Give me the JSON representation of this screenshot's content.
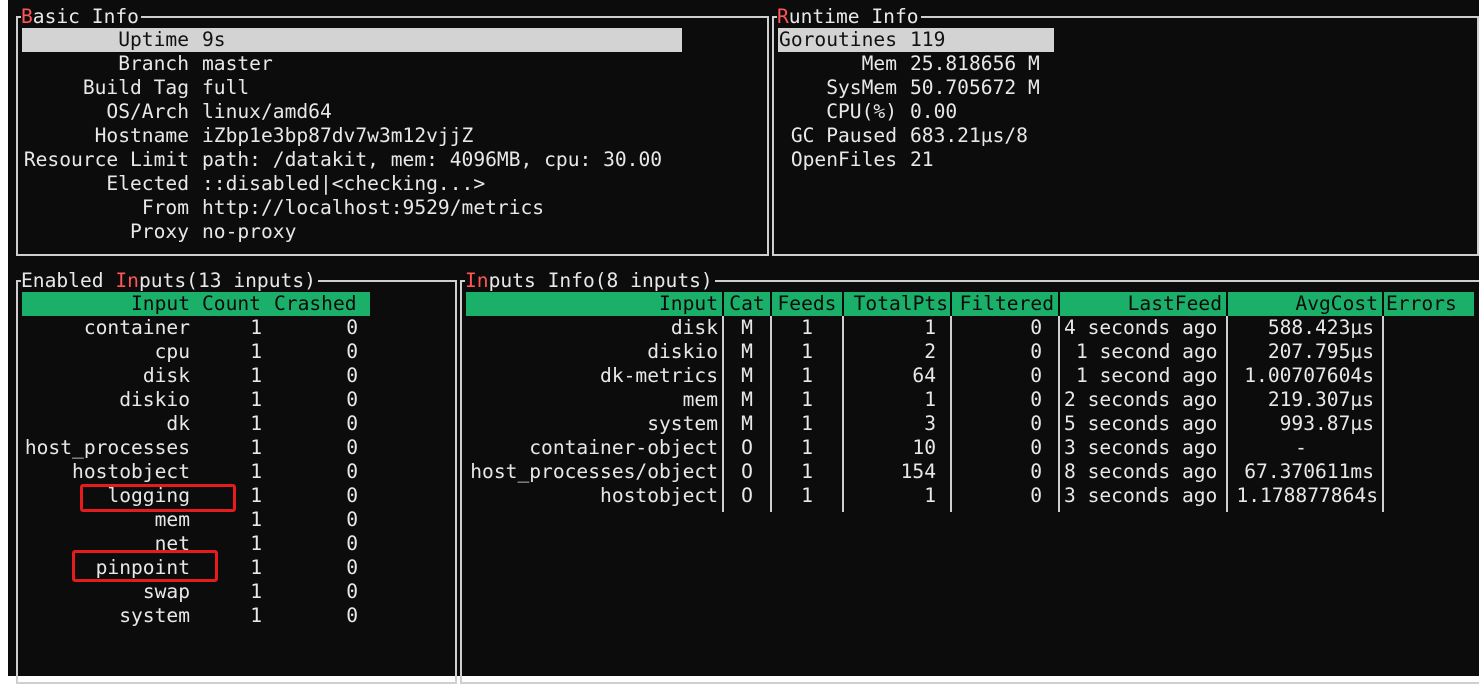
{
  "basic_info": {
    "title_first": "B",
    "title_rest": "asic Info",
    "rows": [
      {
        "label": "Uptime",
        "value": "9s"
      },
      {
        "label": "Branch",
        "value": "master"
      },
      {
        "label": "Build Tag",
        "value": "full"
      },
      {
        "label": "OS/Arch",
        "value": "linux/amd64"
      },
      {
        "label": "Hostname",
        "value": "iZbp1e3bp87dv7w3m12vjjZ"
      },
      {
        "label": "Resource Limit",
        "value": "path: /datakit, mem: 4096MB, cpu: 30.00"
      },
      {
        "label": "Elected",
        "value": "::disabled|<checking...>"
      },
      {
        "label": "From",
        "value": "http://localhost:9529/metrics"
      },
      {
        "label": "Proxy",
        "value": "no-proxy"
      }
    ]
  },
  "runtime_info": {
    "title_first": "R",
    "title_rest": "untime Info",
    "rows": [
      {
        "label": "Goroutines",
        "value": "119"
      },
      {
        "label": "Mem",
        "value": "25.818656 M"
      },
      {
        "label": "SysMem",
        "value": "50.705672 M"
      },
      {
        "label": "CPU(%)",
        "value": "0.00"
      },
      {
        "label": "GC Paused",
        "value": "683.21µs/8"
      },
      {
        "label": "OpenFiles",
        "value": "21"
      }
    ]
  },
  "enabled_inputs": {
    "title_a": "Enabled ",
    "title_hl": "In",
    "title_b": "puts(13 inputs)",
    "headers": {
      "input": "Input",
      "count": "Count",
      "crashed": "Crashed"
    },
    "rows": [
      {
        "input": "container",
        "count": "1",
        "crashed": "0"
      },
      {
        "input": "cpu",
        "count": "1",
        "crashed": "0"
      },
      {
        "input": "disk",
        "count": "1",
        "crashed": "0"
      },
      {
        "input": "diskio",
        "count": "1",
        "crashed": "0"
      },
      {
        "input": "dk",
        "count": "1",
        "crashed": "0"
      },
      {
        "input": "host_processes",
        "count": "1",
        "crashed": "0"
      },
      {
        "input": "hostobject",
        "count": "1",
        "crashed": "0"
      },
      {
        "input": "logging",
        "count": "1",
        "crashed": "0"
      },
      {
        "input": "mem",
        "count": "1",
        "crashed": "0"
      },
      {
        "input": "net",
        "count": "1",
        "crashed": "0"
      },
      {
        "input": "pinpoint",
        "count": "1",
        "crashed": "0"
      },
      {
        "input": "swap",
        "count": "1",
        "crashed": "0"
      },
      {
        "input": "system",
        "count": "1",
        "crashed": "0"
      }
    ]
  },
  "inputs_info": {
    "title_hl": "In",
    "title_b": "puts Info(8 inputs)",
    "headers": {
      "input": "Input",
      "cat": "Cat",
      "feeds": "Feeds",
      "totalpts": "TotalPts",
      "filtered": "Filtered",
      "lastfeed": "LastFeed",
      "avgcost": "AvgCost",
      "errors": "Errors"
    },
    "rows": [
      {
        "input": "disk",
        "cat": "M",
        "feeds": "1",
        "totalpts": "1",
        "filtered": "0",
        "lastfeed": "4 seconds ago",
        "avgcost": "588.423µs",
        "errors": ""
      },
      {
        "input": "diskio",
        "cat": "M",
        "feeds": "1",
        "totalpts": "2",
        "filtered": "0",
        "lastfeed": "1 second ago",
        "avgcost": "207.795µs",
        "errors": ""
      },
      {
        "input": "dk-metrics",
        "cat": "M",
        "feeds": "1",
        "totalpts": "64",
        "filtered": "0",
        "lastfeed": "1 second ago",
        "avgcost": "1.00707604s",
        "errors": ""
      },
      {
        "input": "mem",
        "cat": "M",
        "feeds": "1",
        "totalpts": "1",
        "filtered": "0",
        "lastfeed": "2 seconds ago",
        "avgcost": "219.307µs",
        "errors": ""
      },
      {
        "input": "system",
        "cat": "M",
        "feeds": "1",
        "totalpts": "3",
        "filtered": "0",
        "lastfeed": "5 seconds ago",
        "avgcost": "993.87µs",
        "errors": ""
      },
      {
        "input": "container-object",
        "cat": "O",
        "feeds": "1",
        "totalpts": "10",
        "filtered": "0",
        "lastfeed": "3 seconds ago",
        "avgcost": "-",
        "errors": ""
      },
      {
        "input": "host_processes/object",
        "cat": "O",
        "feeds": "1",
        "totalpts": "154",
        "filtered": "0",
        "lastfeed": "8 seconds ago",
        "avgcost": "67.370611ms",
        "errors": ""
      },
      {
        "input": "hostobject",
        "cat": "O",
        "feeds": "1",
        "totalpts": "1",
        "filtered": "0",
        "lastfeed": "3 seconds ago",
        "avgcost": "1.178877864s",
        "errors": ""
      }
    ]
  },
  "colors": {
    "header_green": "#1bb06a",
    "title_red": "#ff5555",
    "highlight_gray": "#d3d3d3",
    "annotation_red": "#e51c1c"
  }
}
